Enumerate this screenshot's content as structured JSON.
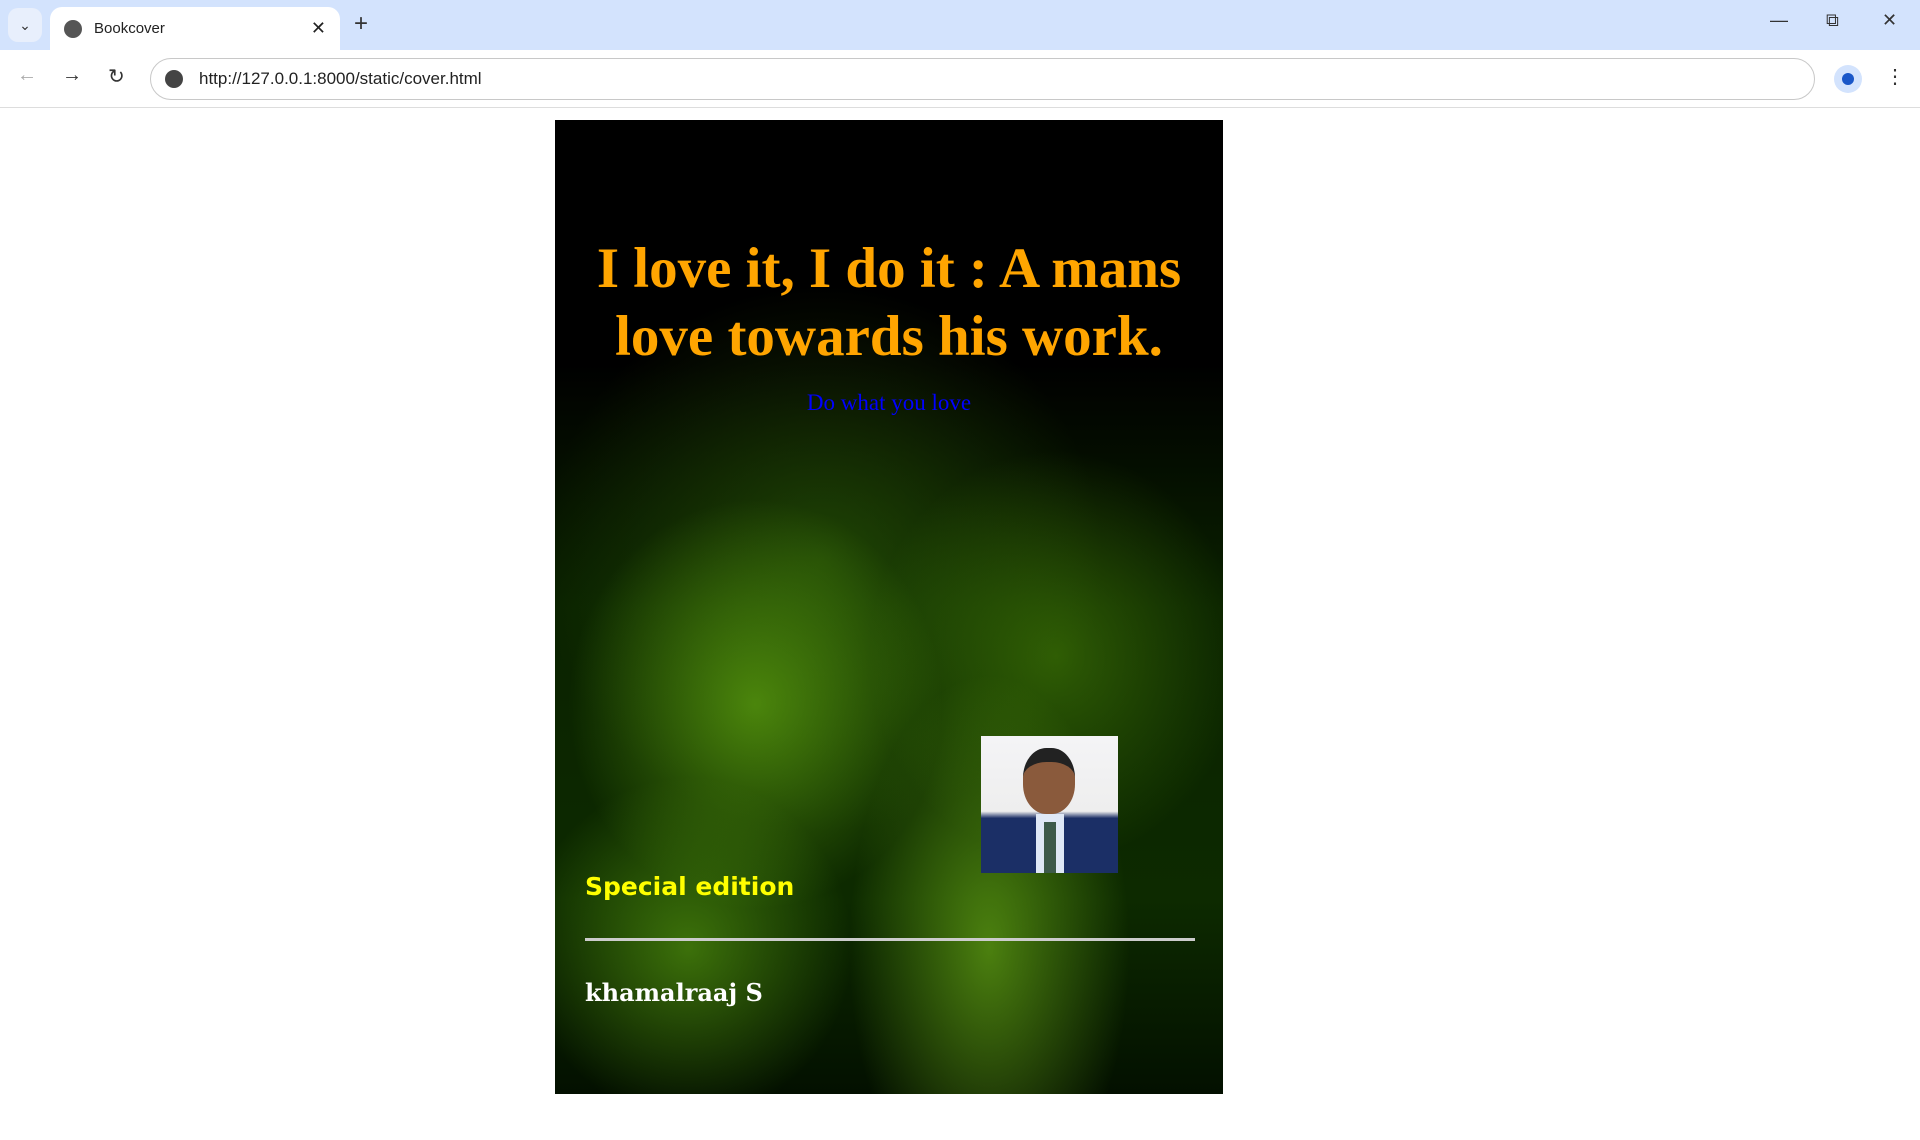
{
  "browser": {
    "tab_title": "Bookcover",
    "url": "http://127.0.0.1:8000/static/cover.html"
  },
  "cover": {
    "title": "I love it, I do it : A mans love towards his work.",
    "subtitle": "Do what you love",
    "edition": "Special edition",
    "author": "khamalraaj S",
    "colors": {
      "title": "#ffa500",
      "subtitle": "#0000ff",
      "edition": "#ffff00",
      "author": "#ffffff"
    }
  }
}
